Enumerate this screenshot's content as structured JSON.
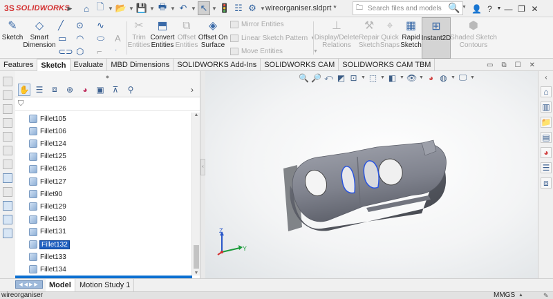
{
  "app": {
    "logo_text": "SOLIDWORKS",
    "logo_mark": "3S"
  },
  "document": {
    "title": "wireorganiser.sldprt *"
  },
  "search": {
    "placeholder": "Search files and models"
  },
  "window_controls": [
    "help-icon",
    "minimize",
    "restore",
    "close"
  ],
  "ribbon": {
    "sketch": "Sketch",
    "smart_dimension": "Smart\nDimension",
    "trim_entities": "Trim\nEntities",
    "convert_entities": "Convert\nEntities",
    "offset_entities": "Offset\nEntities",
    "offset_on_surface": "Offset On\nSurface",
    "mirror_entities": "Mirror Entities",
    "linear_sketch_pattern": "Linear Sketch Pattern",
    "move_entities": "Move Entities",
    "display_delete_relations": "Display/Delete\nRelations",
    "repair_sketch": "Repair\nSketch",
    "quick_snaps": "Quick\nSnaps",
    "rapid_sketch": "Rapid\nSketch",
    "instant2d": "Instant2D",
    "shaded_sketch_contours": "Shaded Sketch\nContours"
  },
  "tabs": [
    {
      "label": "Features",
      "active": false
    },
    {
      "label": "Sketch",
      "active": true
    },
    {
      "label": "Evaluate",
      "active": false
    },
    {
      "label": "MBD Dimensions",
      "active": false
    },
    {
      "label": "SOLIDWORKS Add-Ins",
      "active": false
    },
    {
      "label": "SOLIDWORKS CAM",
      "active": false
    },
    {
      "label": "SOLIDWORKS CAM TBM",
      "active": false
    }
  ],
  "feature_tree": {
    "items": [
      {
        "label": "Fillet105",
        "selected": false
      },
      {
        "label": "Fillet106",
        "selected": false
      },
      {
        "label": "Fillet124",
        "selected": false
      },
      {
        "label": "Fillet125",
        "selected": false
      },
      {
        "label": "Fillet126",
        "selected": false
      },
      {
        "label": "Fillet127",
        "selected": false
      },
      {
        "label": "Fillet90",
        "selected": false
      },
      {
        "label": "Fillet129",
        "selected": false
      },
      {
        "label": "Fillet130",
        "selected": false
      },
      {
        "label": "Fillet131",
        "selected": false
      },
      {
        "label": "Fillet132",
        "selected": true
      },
      {
        "label": "Fillet133",
        "selected": false
      },
      {
        "label": "Fillet134",
        "selected": false
      }
    ]
  },
  "triad": {
    "x_label": "Y",
    "z_label": "Z"
  },
  "bottom_tabs": [
    {
      "label": "Model",
      "active": true
    },
    {
      "label": "Motion Study 1",
      "active": false
    }
  ],
  "status": {
    "left": "wireorganiser",
    "units": "MMGS"
  },
  "colors": {
    "selection": "#1f5fbf",
    "model": "#8c8f99",
    "edge_highlight": "#2a55e0"
  }
}
